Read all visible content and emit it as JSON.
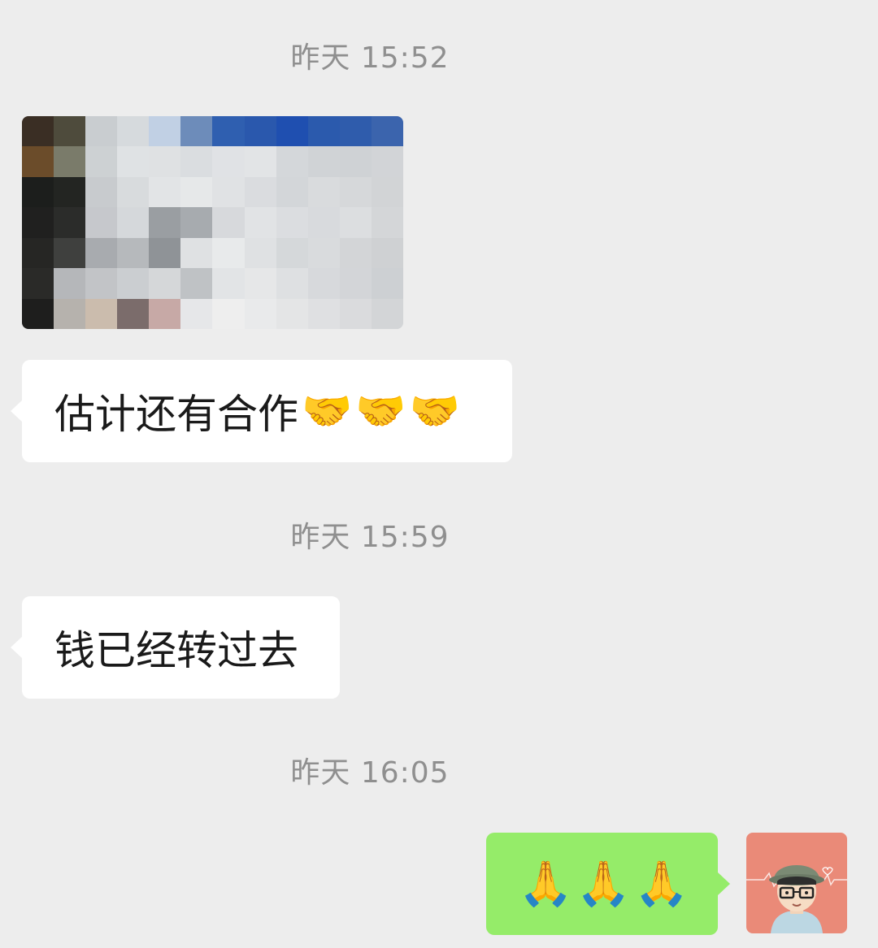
{
  "messages": [
    {
      "type": "timestamp",
      "text": "昨天 15:52"
    },
    {
      "type": "image",
      "side": "left",
      "content": "pixelated-screenshot"
    },
    {
      "type": "text",
      "side": "left",
      "text": "估计还有合作",
      "emoji": [
        "🤝",
        "🤝",
        "🤝"
      ]
    },
    {
      "type": "timestamp",
      "text": "昨天 15:59"
    },
    {
      "type": "text",
      "side": "left",
      "text": "钱已经转过去"
    },
    {
      "type": "timestamp",
      "text": "昨天 16:05"
    },
    {
      "type": "emoji",
      "side": "right",
      "emoji": [
        "🙏",
        "🙏",
        "🙏"
      ]
    }
  ],
  "colors": {
    "background": "#ededed",
    "incoming_bubble": "#ffffff",
    "outgoing_bubble": "#95ec69",
    "timestamp": "#8f8f8f",
    "avatar_bg": "#ea8a78"
  },
  "icons": {
    "handshake": "handshake-emoji",
    "pray": "folded-hands-emoji"
  }
}
